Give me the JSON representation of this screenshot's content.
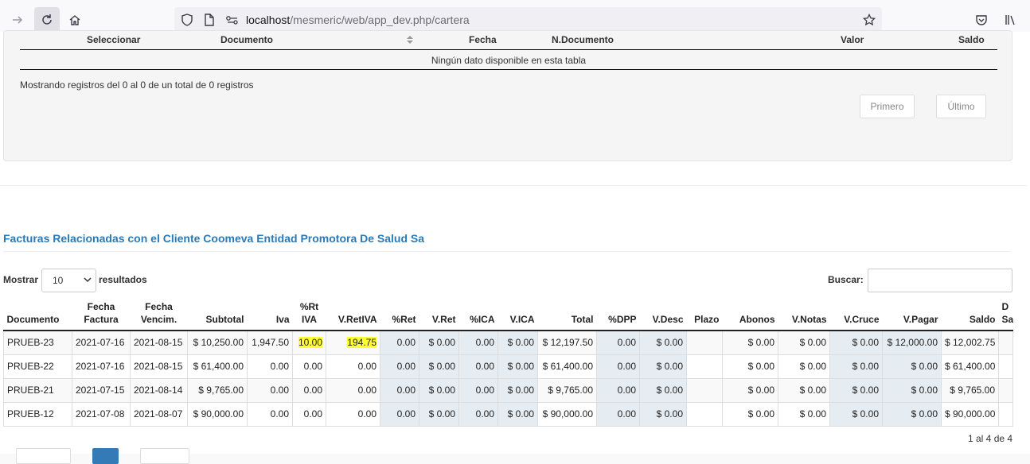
{
  "browser": {
    "url_host": "localhost",
    "url_path": "/mesmeric/web/app_dev.php/cartera"
  },
  "top_table": {
    "headers": [
      "Seleccionar",
      "Documento",
      "Fecha",
      "N.Documento",
      "Valor",
      "Saldo"
    ],
    "empty_text": "Ningún dato disponible en esta tabla",
    "info": "Mostrando registros del 0 al 0 de un total de 0 registros",
    "first_label": "Primero",
    "last_label": "Último"
  },
  "section_title": "Facturas Relacionadas con el Cliente Coomeva Entidad Promotora De Salud Sa",
  "length": {
    "label_before": "Mostrar",
    "value": "10",
    "label_after": "resultados"
  },
  "search": {
    "label": "Buscar:"
  },
  "grid": {
    "headers": [
      [
        "Documento"
      ],
      [
        "Fecha",
        "Factura"
      ],
      [
        "Fecha",
        "Vencim."
      ],
      [
        "Subtotal"
      ],
      [
        "Iva"
      ],
      [
        "%Rt",
        "IVA"
      ],
      [
        "V.RetIVA"
      ],
      [
        "%Ret"
      ],
      [
        "V.Ret"
      ],
      [
        "%ICA"
      ],
      [
        "V.ICA"
      ],
      [
        "Total"
      ],
      [
        "%DPP"
      ],
      [
        "V.Desc"
      ],
      [
        "Plazo"
      ],
      [
        "Abonos"
      ],
      [
        "V.Notas"
      ],
      [
        "V.Cruce"
      ],
      [
        "V.Pagar"
      ],
      [
        "Saldo"
      ],
      [
        "D",
        "Sa"
      ]
    ],
    "rows": [
      [
        "PRUEB-23",
        "2021-07-16",
        "2021-08-15",
        "$ 10,250.00",
        "1,947.50",
        "10.00",
        "194.75",
        "0.00",
        "$ 0.00",
        "0.00",
        "$ 0.00",
        "$ 12,197.50",
        "0.00",
        "$ 0.00",
        "",
        "$ 0.00",
        "$ 0.00",
        "$ 0.00",
        "$ 12,000.00",
        "$ 12,002.75",
        ""
      ],
      [
        "PRUEB-22",
        "2021-07-16",
        "2021-08-15",
        "$ 61,400.00",
        "0.00",
        "0.00",
        "0.00",
        "0.00",
        "$ 0.00",
        "0.00",
        "$ 0.00",
        "$ 61,400.00",
        "0.00",
        "$ 0.00",
        "",
        "$ 0.00",
        "$ 0.00",
        "$ 0.00",
        "$ 0.00",
        "$ 61,400.00",
        ""
      ],
      [
        "PRUEB-21",
        "2021-07-15",
        "2021-08-14",
        "$ 9,765.00",
        "0.00",
        "0.00",
        "0.00",
        "0.00",
        "$ 0.00",
        "0.00",
        "$ 0.00",
        "$ 9,765.00",
        "0.00",
        "$ 0.00",
        "",
        "$ 0.00",
        "$ 0.00",
        "$ 0.00",
        "$ 0.00",
        "$ 9,765.00",
        ""
      ],
      [
        "PRUEB-12",
        "2021-07-08",
        "2021-08-07",
        "$ 90,000.00",
        "0.00",
        "0.00",
        "0.00",
        "0.00",
        "$ 0.00",
        "0.00",
        "$ 0.00",
        "$ 90,000.00",
        "0.00",
        "$ 0.00",
        "",
        "$ 0.00",
        "$ 0.00",
        "$ 0.00",
        "$ 0.00",
        "$ 90,000.00",
        ""
      ]
    ],
    "highlight_color": "#ffff33",
    "info": "1 al 4 de 4"
  },
  "colors": {
    "title": "#2a7ab8",
    "shaded_column": "#e6edf2",
    "active_page": "#337ab7"
  },
  "icons": [
    "forward-icon",
    "reload-icon",
    "home-icon",
    "shield-icon",
    "page-icon",
    "permissions-icon",
    "bookmark-star-icon",
    "pocket-icon",
    "library-icon",
    "sort-icon",
    "chevron-down-icon"
  ]
}
